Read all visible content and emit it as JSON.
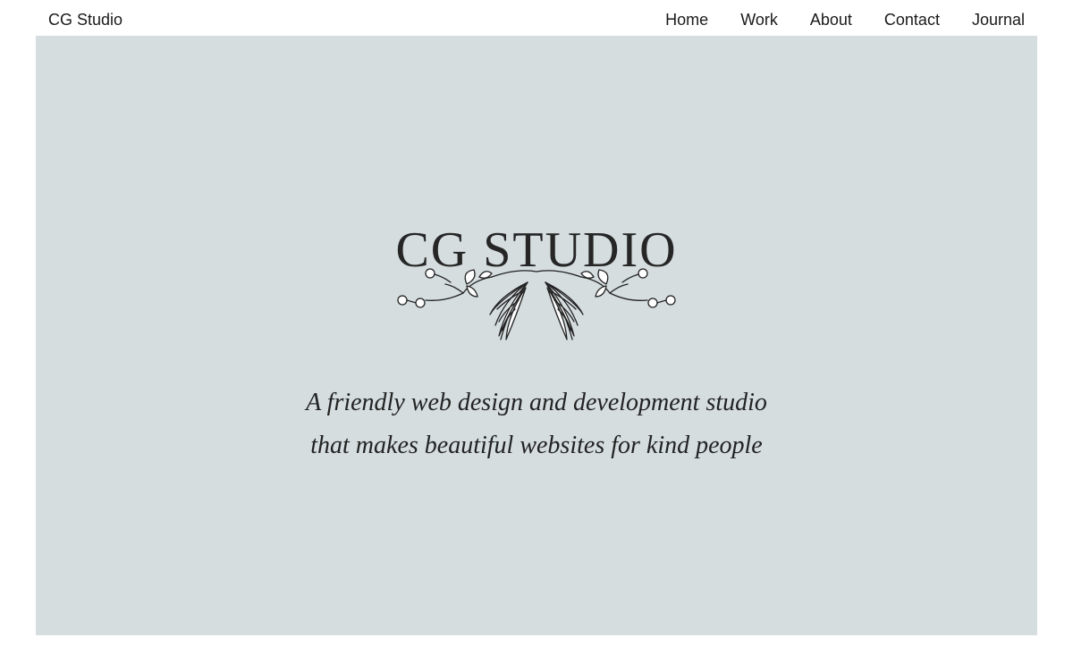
{
  "header": {
    "site_name": "CG Studio",
    "nav": [
      "Home",
      "Work",
      "About",
      "Contact",
      "Journal"
    ]
  },
  "hero": {
    "title": "CG STUDIO",
    "tagline_line1": "A friendly web design and development studio",
    "tagline_line2": "that makes beautiful websites for kind people",
    "ornament_icon": "floral-branch-icon",
    "background_color": "#d5dddf"
  }
}
